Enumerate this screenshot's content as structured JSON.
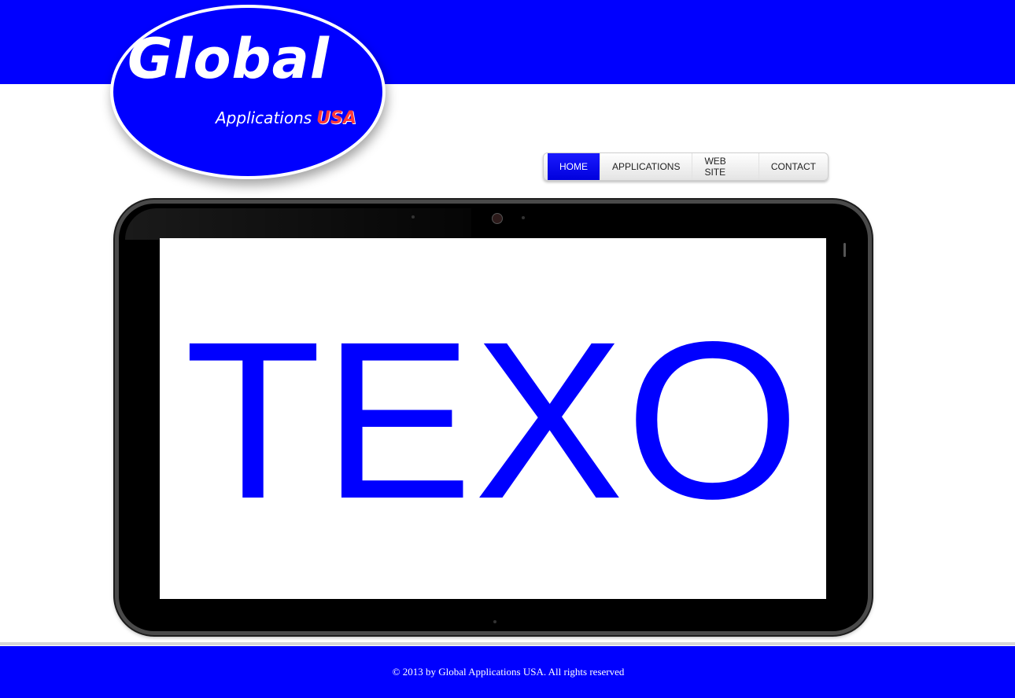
{
  "header": {
    "logo_title": "Global",
    "logo_subtitle": "Applications",
    "logo_badge": "USA"
  },
  "nav": {
    "items": [
      {
        "label": "HOME",
        "active": true
      },
      {
        "label": "APPLICATIONS",
        "active": false
      },
      {
        "label": "WEB SITE",
        "active": false
      },
      {
        "label": "CONTACT",
        "active": false
      }
    ]
  },
  "main": {
    "tablet_screen_text": "TEXO"
  },
  "footer": {
    "copyright": "© 2013 by Global Applications USA. All rights reserved"
  },
  "colors": {
    "brand_blue": "#0000ff",
    "active_nav": "#0000ee",
    "background": "#ffffff"
  }
}
